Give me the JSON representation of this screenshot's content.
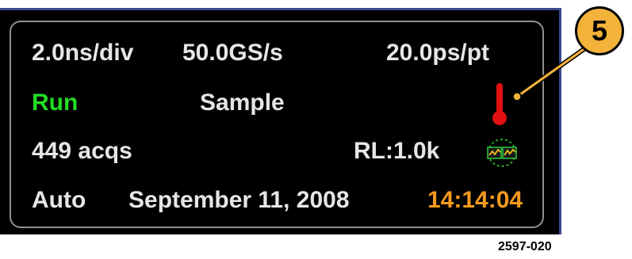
{
  "status_panel": {
    "row1": {
      "horizontal_scale": "2.0ns/div",
      "sample_rate": "50.0GS/s",
      "resolution": "20.0ps/pt"
    },
    "row2": {
      "run_state": "Run",
      "acquisition_mode": "Sample",
      "thermometer_icon": "thermometer-icon"
    },
    "row3": {
      "acquisition_count": "449 acqs",
      "record_length": "RL:1.0k",
      "acquisition_icon": "acquisition-status-icon"
    },
    "row4": {
      "trigger_mode": "Auto",
      "date": "September 11, 2008",
      "time": "14:14:04"
    }
  },
  "callout": {
    "number": "5"
  },
  "figure_number": "2597-020",
  "colors": {
    "run_state": "#22dd22",
    "time": "#f39a1e",
    "thermometer": "#e01010",
    "callout_fill": "#f3b23a",
    "panel_text": "#e6e6e6",
    "bezel_edge": "#3a4a8c"
  }
}
